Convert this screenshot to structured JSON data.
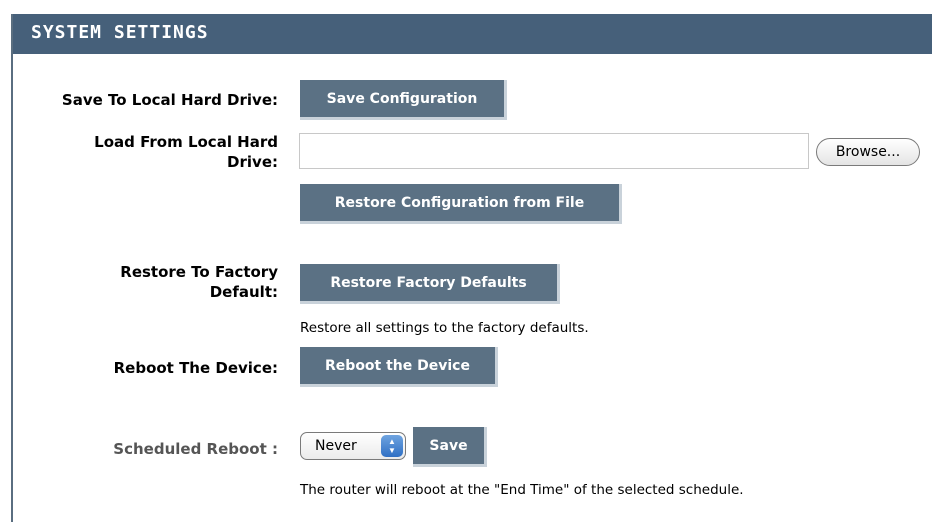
{
  "header": {
    "title": "SYSTEM SETTINGS"
  },
  "save_local": {
    "label": "Save To Local Hard Drive:",
    "button": "Save Configuration"
  },
  "load_local": {
    "label_line1": "Load From Local Hard",
    "label_line2": "Drive:",
    "file_value": "",
    "browse_button": "Browse...",
    "restore_button": "Restore Configuration from File"
  },
  "factory": {
    "label_line1": "Restore To Factory",
    "label_line2": "Default:",
    "button": "Restore Factory Defaults",
    "description": "Restore all settings to the factory defaults."
  },
  "reboot": {
    "label": "Reboot The Device:",
    "button": "Reboot the Device"
  },
  "scheduled_reboot": {
    "label": "Scheduled Reboot :",
    "selected": "Never",
    "save_button": "Save",
    "description": "The router will reboot at the \"End Time\" of the selected schedule."
  },
  "colors": {
    "header_bg": "#46607a",
    "button_bg": "#5b7184",
    "select_accent": "#2f6fc4"
  }
}
